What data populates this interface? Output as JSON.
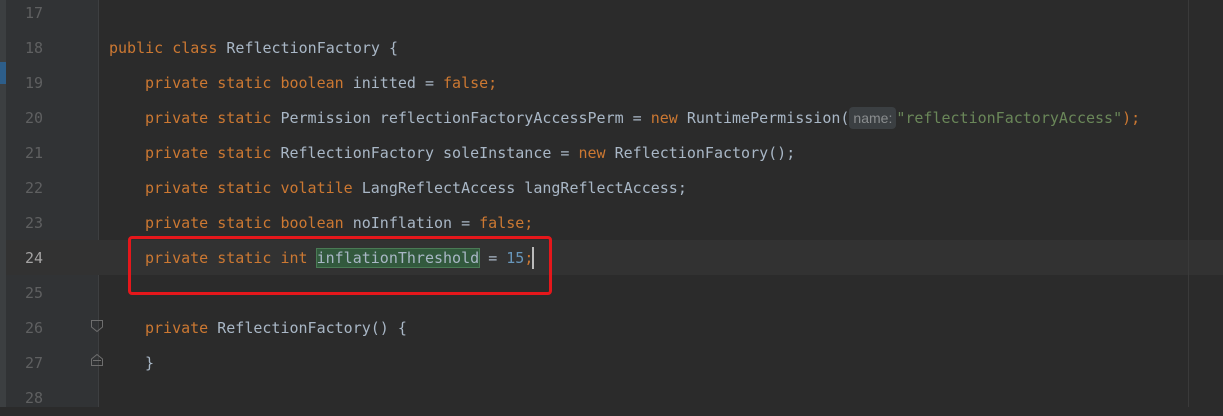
{
  "lines": [
    {
      "n": "17"
    },
    {
      "n": "18",
      "kw1": "public class",
      "name": "ReflectionFactory {"
    },
    {
      "n": "19",
      "kw1": "private static boolean",
      "t1": "initted =",
      "kw2": "false;"
    },
    {
      "n": "20",
      "kw1": "private static",
      "t1": "Permission reflectionFactoryAccessPerm =",
      "kw2": "new",
      "t2": "RuntimePermission(",
      "hint": "name:",
      "str": "\"reflectionFactoryAccess\"",
      "t3": ");"
    },
    {
      "n": "21",
      "kw1": "private static",
      "t1": "ReflectionFactory soleInstance =",
      "kw2": "new",
      "t2": "ReflectionFactory();"
    },
    {
      "n": "22",
      "kw1": "private static volatile",
      "t1": "LangReflectAccess langReflectAccess;"
    },
    {
      "n": "23",
      "kw1": "private static boolean",
      "t1": "noInflation =",
      "kw2": "false;"
    },
    {
      "n": "24",
      "kw1": "private static int",
      "sel": "inflationThreshold",
      "t1": "=",
      "num": "15",
      "kw2": ";"
    },
    {
      "n": "25"
    },
    {
      "n": "26",
      "kw1": "private",
      "t1": "ReflectionFactory() {"
    },
    {
      "n": "27",
      "t1": "}"
    },
    {
      "n": "28"
    }
  ]
}
